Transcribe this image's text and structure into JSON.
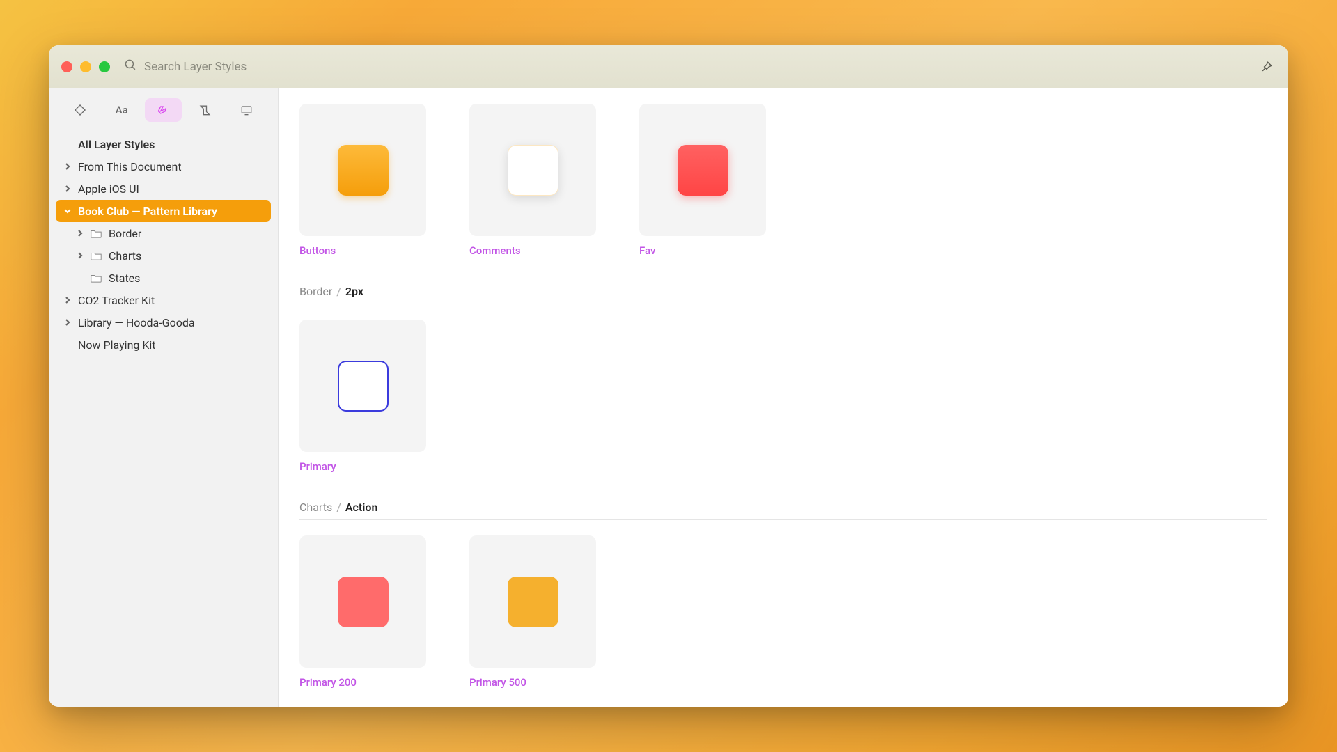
{
  "titlebar": {
    "search_placeholder": "Search Layer Styles"
  },
  "filter_tabs": {
    "aa_label": "Aa"
  },
  "sidebar": {
    "all_label": "All Layer Styles",
    "items": [
      {
        "label": "From This Document"
      },
      {
        "label": "Apple iOS UI"
      },
      {
        "label": "Book Club — Pattern Library"
      },
      {
        "label": "CO2 Tracker Kit"
      },
      {
        "label": "Library — Hooda-Gooda"
      },
      {
        "label": "Now Playing Kit"
      }
    ],
    "sub": {
      "border": "Border",
      "charts": "Charts",
      "states": "States"
    }
  },
  "sections": {
    "top": {
      "cards": [
        {
          "label": "Buttons"
        },
        {
          "label": "Comments"
        },
        {
          "label": "Fav"
        }
      ]
    },
    "border": {
      "crumb_parent": "Border",
      "crumb_active": "2px",
      "cards": [
        {
          "label": "Primary"
        }
      ]
    },
    "charts": {
      "crumb_parent": "Charts",
      "crumb_active": "Action",
      "cards": [
        {
          "label": "Primary 200"
        },
        {
          "label": "Primary 500"
        }
      ]
    }
  }
}
